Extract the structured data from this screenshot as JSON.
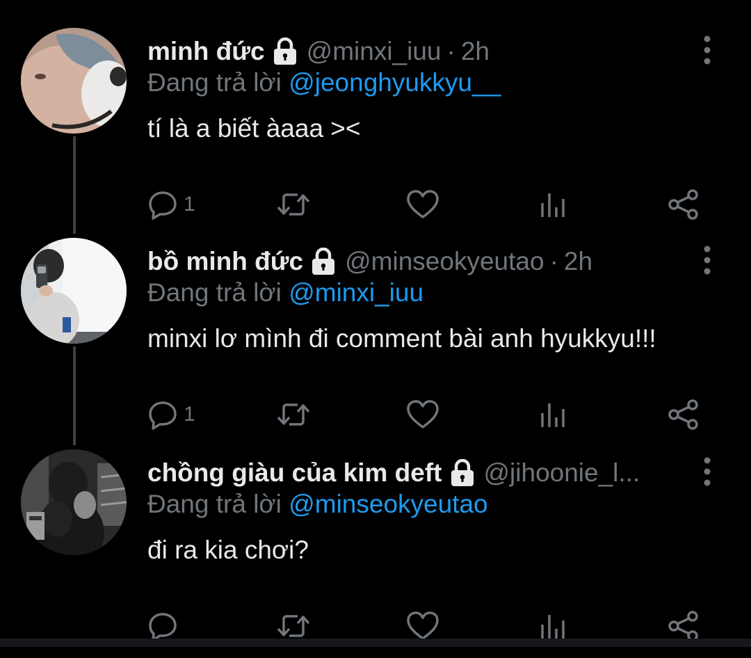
{
  "colors": {
    "background": "#000000",
    "text": "#e7e9ea",
    "muted": "#71767b",
    "accent": "#1d9bf0",
    "thread_line": "#3e4144"
  },
  "tweets": [
    {
      "name": "minh đức",
      "handle": "@minxi_iuu",
      "dot": "·",
      "time": "2h",
      "replying_prefix": "Đang trả lời",
      "replying_to": "@jeonghyukkyu__",
      "text": "tí là a biết àaaa ><",
      "reply_count": "1",
      "icons": [
        "lock-icon",
        "more-icon",
        "reply-icon",
        "retweet-icon",
        "like-icon",
        "stats-icon",
        "share-icon"
      ]
    },
    {
      "name": "bồ minh đức",
      "handle": "@minseokyeutao",
      "dot": "·",
      "time": "2h",
      "replying_prefix": "Đang trả lời",
      "replying_to": "@minxi_iuu",
      "text": "minxi lơ mình đi comment bài anh hyukkyu!!!",
      "reply_count": "1",
      "icons": [
        "lock-icon",
        "more-icon",
        "reply-icon",
        "retweet-icon",
        "like-icon",
        "stats-icon",
        "share-icon"
      ]
    },
    {
      "name": "chồng giàu của kim deft",
      "handle": "@jihoonie_l...",
      "dot": "",
      "time": "",
      "replying_prefix": "Đang trả lời",
      "replying_to": "@minseokyeutao",
      "text": "đi ra kia chơi?",
      "reply_count": "",
      "icons": [
        "lock-icon",
        "more-icon",
        "reply-icon",
        "retweet-icon",
        "like-icon",
        "stats-icon",
        "share-icon"
      ]
    }
  ]
}
